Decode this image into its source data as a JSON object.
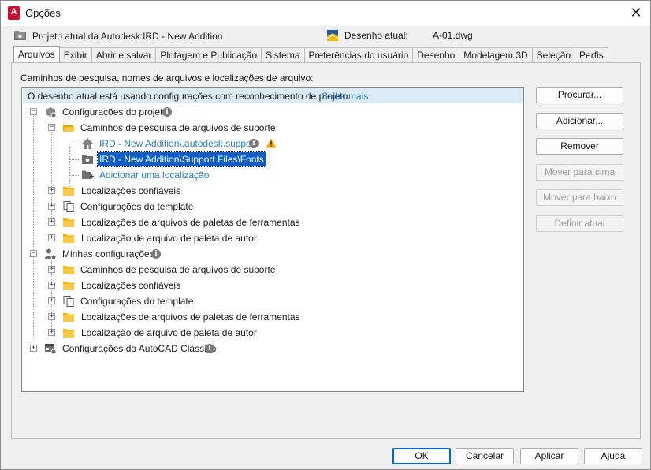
{
  "window": {
    "title": "Opções"
  },
  "info": {
    "project_text": "Projeto atual da Autodesk:IRD - New Addition",
    "drawing_label": "Desenho atual:",
    "drawing_value": "A-01.dwg"
  },
  "tabs": [
    "Arquivos",
    "Exibir",
    "Abrir e salvar",
    "Plotagem e Publicação",
    "Sistema",
    "Preferências do usuário",
    "Desenho",
    "Modelagem 3D",
    "Seleção",
    "Perfis"
  ],
  "panel": {
    "caption": "Caminhos de pesquisa, nomes de arquivos e localizações de arquivo:",
    "banner_text": "O desenho atual está usando configurações com reconhecimento de projeto.",
    "banner_link": "Saiba mais"
  },
  "tree": {
    "project_settings": "Configurações do projeto",
    "support_paths": "Caminhos de pesquisa de arquivos de suporte",
    "path_1": "IRD - New Addition\\.autodesk.support",
    "path_2": "IRD - New Addition\\Support Files\\Fonts",
    "add_location": "Adicionar uma localização",
    "trusted": "Localizações confiáveis",
    "template": "Configurações do template",
    "tool_palettes": "Localizações de arquivos de paletas de ferramentas",
    "author_palette": "Localização de arquivo de paleta de autor",
    "my_settings": "Minhas configurações",
    "my_support_paths": "Caminhos de pesquisa de arquivos de suporte",
    "my_trusted": "Localizações confiáveis",
    "my_template": "Configurações do template",
    "my_tool_palettes": "Localizações de arquivos de paletas de ferramentas",
    "my_author_palette": "Localização de arquivo de paleta de autor",
    "classic": "Configurações do AutoCAD Clássico"
  },
  "side_buttons": {
    "browse": "Procurar...",
    "add": "Adicionar...",
    "remove": "Remover",
    "move_up": "Mover para cima",
    "move_down": "Mover para baixo",
    "set_current": "Definir atual"
  },
  "footer": {
    "ok": "OK",
    "cancel": "Cancelar",
    "apply": "Aplicar",
    "help": "Ajuda"
  },
  "colors": {
    "accent": "#0067c0",
    "link": "#2a7ec1",
    "selection": "#0a5ec8",
    "banner": "#dcebf6",
    "folder": "#f2b705"
  }
}
